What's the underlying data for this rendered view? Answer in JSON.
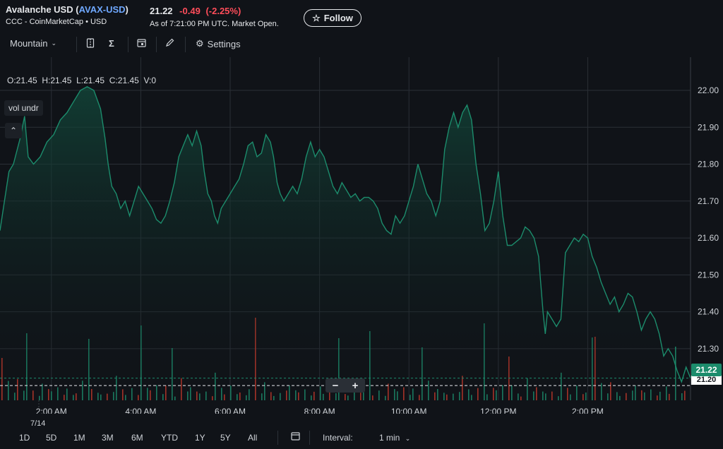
{
  "header": {
    "name": "Avalanche USD",
    "symbol": "AVAX-USD",
    "source": "CCC - CoinMarketCap • USD",
    "price": "21.22",
    "change": "-0.49",
    "change_pct": "(-2.25%)",
    "as_of": "As of 7:21:00 PM UTC. Market Open.",
    "follow_label": "Follow",
    "follow_icon": "star-outline-icon"
  },
  "toolbar": {
    "chart_type": "Mountain",
    "settings_label": "Settings",
    "icons": [
      "compare-icon",
      "indicators-sigma-icon",
      "calendar-event-icon",
      "draw-pencil-icon",
      "gear-icon"
    ]
  },
  "legend": {
    "ohlcv": "O:21.45  H:21.45  L:21.45  C:21.45  V:0",
    "volume_toggle": "vol undr"
  },
  "zoom": {
    "minus": "−",
    "plus": "+"
  },
  "price_label": "21.22",
  "price_label_secondary": "21.20",
  "date_label": "7/14",
  "bottombar": {
    "ranges": [
      "1D",
      "5D",
      "1M",
      "3M",
      "6M",
      "YTD",
      "1Y",
      "5Y",
      "All"
    ],
    "interval_label": "Interval:",
    "interval_value": "1 min"
  },
  "colors": {
    "background": "#101318",
    "line": "#1c8c6c",
    "area_top": "#124a3c",
    "volume_up": "#1c8c6c",
    "volume_down": "#c0392b",
    "negative": "#ff4d5a",
    "link": "#6fa8ff"
  },
  "chart_data": {
    "type": "area",
    "title": "",
    "xlabel": "",
    "ylabel": "",
    "x_ticks": [
      "2:00 AM",
      "4:00 AM",
      "6:00 AM",
      "8:00 AM",
      "10:00 AM",
      "12:00 PM",
      "2:00 PM"
    ],
    "y_ticks": [
      21.3,
      21.4,
      21.5,
      21.6,
      21.7,
      21.8,
      21.9,
      22.0
    ],
    "ylim": [
      21.16,
      22.09
    ],
    "xlim_hours": [
      0.85,
      15.25
    ],
    "grid": true,
    "series": [
      {
        "values": [
          [
            0.85,
            21.62
          ],
          [
            0.95,
            21.7
          ],
          [
            1.05,
            21.78
          ],
          [
            1.15,
            21.8
          ],
          [
            1.3,
            21.87
          ],
          [
            1.4,
            21.93
          ],
          [
            1.48,
            21.82
          ],
          [
            1.6,
            21.8
          ],
          [
            1.75,
            21.82
          ],
          [
            1.9,
            21.86
          ],
          [
            2.05,
            21.88
          ],
          [
            2.2,
            21.92
          ],
          [
            2.35,
            21.94
          ],
          [
            2.5,
            21.97
          ],
          [
            2.65,
            22.0
          ],
          [
            2.8,
            22.01
          ],
          [
            2.95,
            22.0
          ],
          [
            3.1,
            21.95
          ],
          [
            3.2,
            21.87
          ],
          [
            3.27,
            21.8
          ],
          [
            3.35,
            21.74
          ],
          [
            3.45,
            21.72
          ],
          [
            3.55,
            21.68
          ],
          [
            3.65,
            21.7
          ],
          [
            3.75,
            21.66
          ],
          [
            3.85,
            21.7
          ],
          [
            3.95,
            21.74
          ],
          [
            4.05,
            21.72
          ],
          [
            4.15,
            21.7
          ],
          [
            4.25,
            21.68
          ],
          [
            4.35,
            21.65
          ],
          [
            4.45,
            21.64
          ],
          [
            4.55,
            21.66
          ],
          [
            4.65,
            21.7
          ],
          [
            4.75,
            21.75
          ],
          [
            4.85,
            21.82
          ],
          [
            4.95,
            21.85
          ],
          [
            5.05,
            21.88
          ],
          [
            5.15,
            21.85
          ],
          [
            5.25,
            21.89
          ],
          [
            5.35,
            21.85
          ],
          [
            5.42,
            21.78
          ],
          [
            5.5,
            21.72
          ],
          [
            5.58,
            21.7
          ],
          [
            5.65,
            21.66
          ],
          [
            5.72,
            21.64
          ],
          [
            5.8,
            21.68
          ],
          [
            5.9,
            21.7
          ],
          [
            6.0,
            21.72
          ],
          [
            6.1,
            21.74
          ],
          [
            6.2,
            21.76
          ],
          [
            6.3,
            21.8
          ],
          [
            6.4,
            21.85
          ],
          [
            6.5,
            21.86
          ],
          [
            6.6,
            21.82
          ],
          [
            6.7,
            21.83
          ],
          [
            6.8,
            21.88
          ],
          [
            6.9,
            21.86
          ],
          [
            6.97,
            21.82
          ],
          [
            7.05,
            21.75
          ],
          [
            7.12,
            21.72
          ],
          [
            7.2,
            21.7
          ],
          [
            7.3,
            21.72
          ],
          [
            7.4,
            21.74
          ],
          [
            7.5,
            21.72
          ],
          [
            7.6,
            21.76
          ],
          [
            7.7,
            21.82
          ],
          [
            7.8,
            21.86
          ],
          [
            7.9,
            21.82
          ],
          [
            8.0,
            21.84
          ],
          [
            8.1,
            21.82
          ],
          [
            8.2,
            21.78
          ],
          [
            8.3,
            21.74
          ],
          [
            8.4,
            21.72
          ],
          [
            8.5,
            21.75
          ],
          [
            8.6,
            21.73
          ],
          [
            8.7,
            21.71
          ],
          [
            8.8,
            21.72
          ],
          [
            8.9,
            21.7
          ],
          [
            9.0,
            21.71
          ],
          [
            9.1,
            21.71
          ],
          [
            9.2,
            21.7
          ],
          [
            9.3,
            21.68
          ],
          [
            9.4,
            21.64
          ],
          [
            9.5,
            21.62
          ],
          [
            9.6,
            21.61
          ],
          [
            9.7,
            21.66
          ],
          [
            9.8,
            21.64
          ],
          [
            9.9,
            21.66
          ],
          [
            10.0,
            21.7
          ],
          [
            10.1,
            21.74
          ],
          [
            10.2,
            21.8
          ],
          [
            10.3,
            21.76
          ],
          [
            10.4,
            21.72
          ],
          [
            10.5,
            21.7
          ],
          [
            10.6,
            21.66
          ],
          [
            10.7,
            21.7
          ],
          [
            10.8,
            21.84
          ],
          [
            10.9,
            21.9
          ],
          [
            11.0,
            21.94
          ],
          [
            11.1,
            21.9
          ],
          [
            11.2,
            21.94
          ],
          [
            11.3,
            21.96
          ],
          [
            11.4,
            21.92
          ],
          [
            11.5,
            21.8
          ],
          [
            11.6,
            21.72
          ],
          [
            11.7,
            21.62
          ],
          [
            11.8,
            21.64
          ],
          [
            11.9,
            21.7
          ],
          [
            12.0,
            21.78
          ],
          [
            12.1,
            21.66
          ],
          [
            12.2,
            21.58
          ],
          [
            12.3,
            21.58
          ],
          [
            12.4,
            21.59
          ],
          [
            12.5,
            21.6
          ],
          [
            12.6,
            21.63
          ],
          [
            12.7,
            21.62
          ],
          [
            12.8,
            21.6
          ],
          [
            12.9,
            21.55
          ],
          [
            13.0,
            21.4
          ],
          [
            13.05,
            21.34
          ],
          [
            13.1,
            21.4
          ],
          [
            13.2,
            21.38
          ],
          [
            13.3,
            21.36
          ],
          [
            13.4,
            21.38
          ],
          [
            13.5,
            21.56
          ],
          [
            13.6,
            21.58
          ],
          [
            13.7,
            21.6
          ],
          [
            13.8,
            21.59
          ],
          [
            13.9,
            21.61
          ],
          [
            14.0,
            21.6
          ],
          [
            14.1,
            21.55
          ],
          [
            14.2,
            21.52
          ],
          [
            14.3,
            21.48
          ],
          [
            14.4,
            21.45
          ],
          [
            14.5,
            21.42
          ],
          [
            14.6,
            21.44
          ],
          [
            14.7,
            21.4
          ],
          [
            14.8,
            21.42
          ],
          [
            14.9,
            21.45
          ],
          [
            15.0,
            21.44
          ],
          [
            15.1,
            21.4
          ],
          [
            15.2,
            21.35
          ],
          [
            15.3,
            21.38
          ],
          [
            15.4,
            21.4
          ],
          [
            15.5,
            21.38
          ],
          [
            15.6,
            21.34
          ],
          [
            15.7,
            21.28
          ],
          [
            15.8,
            21.3
          ],
          [
            15.9,
            21.28
          ],
          [
            16.0,
            21.24
          ],
          [
            16.1,
            21.21
          ],
          [
            16.2,
            21.25
          ],
          [
            16.3,
            21.22
          ]
        ]
      }
    ]
  }
}
